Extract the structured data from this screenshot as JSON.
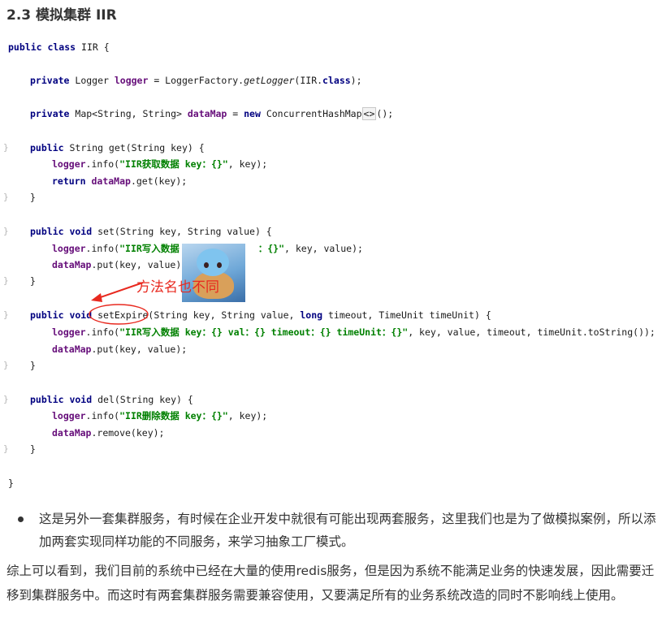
{
  "heading": "2.3 模拟集群 IIR",
  "code": {
    "line1": {
      "kw": "public class ",
      "rest": "IIR {"
    },
    "line2": {
      "kw": "private ",
      "type": "Logger ",
      "fld": "logger",
      "eq": " = LoggerFactory.",
      "call": "getLogger",
      "arg": "(IIR.",
      "cls": "class",
      "end": ");"
    },
    "line3": {
      "kw": "private ",
      "type": "Map<String, String> ",
      "fld": "dataMap",
      "eq": " = ",
      "newkw": "new ",
      "ctor": "ConcurrentHashMap",
      "gen": "<>",
      "end": "();"
    },
    "line4": {
      "kw": "public ",
      "rest": "String get(String key) {"
    },
    "line5": {
      "fld": "logger",
      "call": ".info(",
      "str": "\"IIR获取数据 key：{}\"",
      "end": ", key);"
    },
    "line6": {
      "kw": "return ",
      "fld": "dataMap",
      "end": ".get(key);"
    },
    "line7": "}",
    "line8": {
      "kw": "public void ",
      "rest": "set(String key, String value) {"
    },
    "line9": {
      "fld": "logger",
      "call": ".info(",
      "str": "\"IIR写入数据 ",
      "str2": "：{}\"",
      "end": ", key, value);"
    },
    "line10": {
      "fld": "dataMap",
      "end": ".put(key, value);"
    },
    "line11": "}",
    "line12": {
      "kw": "public void ",
      "method": "setExpire",
      "rest": "(String key, String value, ",
      "kw2": "long ",
      "rest2": "timeout, TimeUnit timeUnit) {"
    },
    "line13": {
      "fld": "logger",
      "call": ".info(",
      "str": "\"IIR写入数据 key：{} val：{} timeout：{} timeUnit：{}\"",
      "end": ", key, value, timeout, timeUnit.toString());"
    },
    "line14": {
      "fld": "dataMap",
      "end": ".put(key, value);"
    },
    "line15": "}",
    "line16": {
      "kw": "public void ",
      "rest": "del(String key) {"
    },
    "line17": {
      "fld": "logger",
      "call": ".info(",
      "str": "\"IIR删除数据 key：{}\"",
      "end": ", key);"
    },
    "line18": {
      "fld": "dataMap",
      "end": ".remove(key);"
    },
    "line19": "}",
    "line20": "}"
  },
  "annotation": "方法名也不同",
  "bullet": "这是另外一套集群服务，有时候在企业开发中就很有可能出现两套服务，这里我们也是为了做模拟案例，所以添加两套实现同样功能的不同服务，来学习抽象工厂模式。",
  "paragraph": "综上可以看到，我们目前的系统中已经在大量的使用redis服务，但是因为系统不能满足业务的快速发展，因此需要迁移到集群服务中。而这时有两套集群服务需要兼容使用，又要满足所有的业务系统改造的同时不影响线上使用。",
  "colors": {
    "keyword": "#000080",
    "field": "#660e7a",
    "string": "#008000",
    "annotation": "#e8291f"
  }
}
